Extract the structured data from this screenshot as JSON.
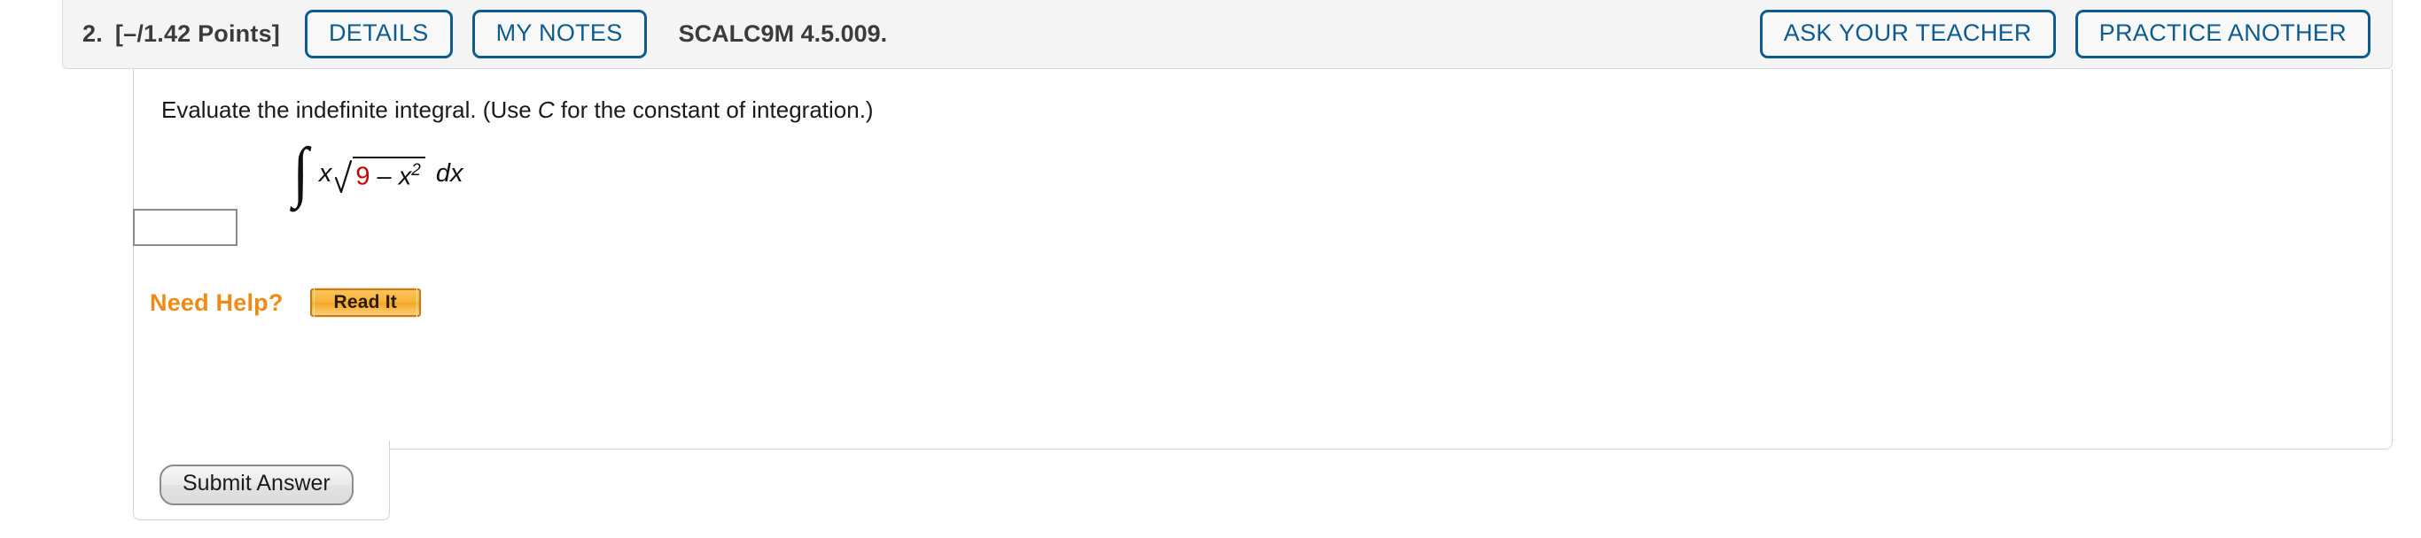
{
  "header": {
    "question_number": "2.",
    "points": "[–/1.42 Points]",
    "details_label": "DETAILS",
    "my_notes_label": "MY NOTES",
    "problem_code": "SCALC9M 4.5.009.",
    "ask_your_teacher_label": "ASK YOUR TEACHER",
    "practice_another_label": "PRACTICE ANOTHER",
    "accent_color": "#0d5c8f",
    "bar_background": "#f4f4f4"
  },
  "question": {
    "prompt_before_c": "Evaluate the indefinite integral. (Use ",
    "prompt_c": "C",
    "prompt_after_c": " for the constant of integration.)",
    "integral_sign": "∫",
    "integrand_var": "x",
    "radical_number": "9",
    "radical_operator": "–",
    "radical_var": "x",
    "radical_exponent": "2",
    "differential": "dx",
    "highlight_color": "#cc0000"
  },
  "answer": {
    "value": "",
    "placeholder": ""
  },
  "help": {
    "label": "Need Help?",
    "read_it_label": "Read It",
    "label_color": "#f08a16"
  },
  "submit": {
    "label": "Submit Answer"
  }
}
